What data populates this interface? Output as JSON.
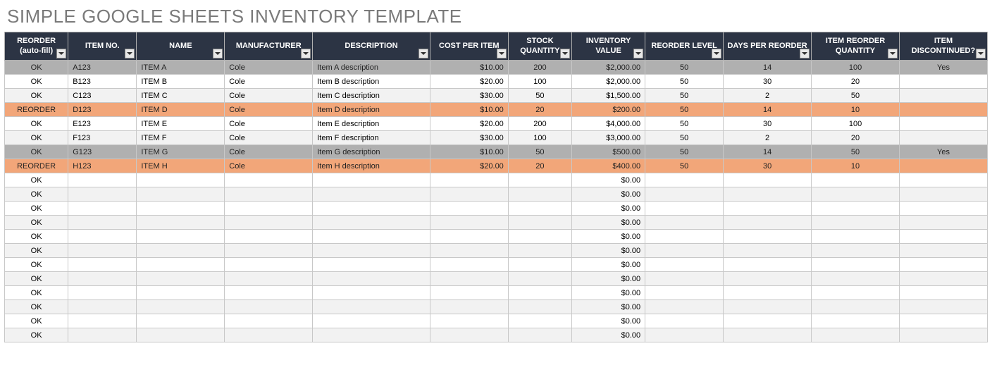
{
  "title": "SIMPLE GOOGLE SHEETS INVENTORY TEMPLATE",
  "columns": [
    {
      "key": "reorder",
      "label": "REORDER (auto-fill)"
    },
    {
      "key": "item_no",
      "label": "ITEM NO."
    },
    {
      "key": "name",
      "label": "NAME"
    },
    {
      "key": "manufacturer",
      "label": "MANUFACTURER"
    },
    {
      "key": "description",
      "label": "DESCRIPTION"
    },
    {
      "key": "cost_per_item",
      "label": "COST PER ITEM"
    },
    {
      "key": "stock_qty",
      "label": "STOCK QUANTITY"
    },
    {
      "key": "inventory_value",
      "label": "INVENTORY VALUE"
    },
    {
      "key": "reorder_level",
      "label": "REORDER LEVEL"
    },
    {
      "key": "days_per_reorder",
      "label": "DAYS PER REORDER"
    },
    {
      "key": "item_reorder_qty",
      "label": "ITEM REORDER QUANTITY"
    },
    {
      "key": "discontinued",
      "label": "ITEM DISCONTINUED?"
    }
  ],
  "rows": [
    {
      "state": "disc",
      "reorder": "OK",
      "item_no": "A123",
      "name": "ITEM A",
      "manufacturer": "Cole",
      "description": "Item A description",
      "cost_per_item": "$10.00",
      "stock_qty": "200",
      "inventory_value": "$2,000.00",
      "reorder_level": "50",
      "days_per_reorder": "14",
      "item_reorder_qty": "100",
      "discontinued": "Yes"
    },
    {
      "state": "normal",
      "reorder": "OK",
      "item_no": "B123",
      "name": "ITEM B",
      "manufacturer": "Cole",
      "description": "Item B description",
      "cost_per_item": "$20.00",
      "stock_qty": "100",
      "inventory_value": "$2,000.00",
      "reorder_level": "50",
      "days_per_reorder": "30",
      "item_reorder_qty": "20",
      "discontinued": ""
    },
    {
      "state": "normal",
      "reorder": "OK",
      "item_no": "C123",
      "name": "ITEM C",
      "manufacturer": "Cole",
      "description": "Item C description",
      "cost_per_item": "$30.00",
      "stock_qty": "50",
      "inventory_value": "$1,500.00",
      "reorder_level": "50",
      "days_per_reorder": "2",
      "item_reorder_qty": "50",
      "discontinued": ""
    },
    {
      "state": "reorder",
      "reorder": "REORDER",
      "item_no": "D123",
      "name": "ITEM D",
      "manufacturer": "Cole",
      "description": "Item D description",
      "cost_per_item": "$10.00",
      "stock_qty": "20",
      "inventory_value": "$200.00",
      "reorder_level": "50",
      "days_per_reorder": "14",
      "item_reorder_qty": "10",
      "discontinued": ""
    },
    {
      "state": "normal",
      "reorder": "OK",
      "item_no": "E123",
      "name": "ITEM E",
      "manufacturer": "Cole",
      "description": "Item E description",
      "cost_per_item": "$20.00",
      "stock_qty": "200",
      "inventory_value": "$4,000.00",
      "reorder_level": "50",
      "days_per_reorder": "30",
      "item_reorder_qty": "100",
      "discontinued": ""
    },
    {
      "state": "normal",
      "reorder": "OK",
      "item_no": "F123",
      "name": "ITEM F",
      "manufacturer": "Cole",
      "description": "Item F description",
      "cost_per_item": "$30.00",
      "stock_qty": "100",
      "inventory_value": "$3,000.00",
      "reorder_level": "50",
      "days_per_reorder": "2",
      "item_reorder_qty": "20",
      "discontinued": ""
    },
    {
      "state": "disc",
      "reorder": "OK",
      "item_no": "G123",
      "name": "ITEM G",
      "manufacturer": "Cole",
      "description": "Item G description",
      "cost_per_item": "$10.00",
      "stock_qty": "50",
      "inventory_value": "$500.00",
      "reorder_level": "50",
      "days_per_reorder": "14",
      "item_reorder_qty": "50",
      "discontinued": "Yes"
    },
    {
      "state": "reorder",
      "reorder": "REORDER",
      "item_no": "H123",
      "name": "ITEM H",
      "manufacturer": "Cole",
      "description": "Item H description",
      "cost_per_item": "$20.00",
      "stock_qty": "20",
      "inventory_value": "$400.00",
      "reorder_level": "50",
      "days_per_reorder": "30",
      "item_reorder_qty": "10",
      "discontinued": ""
    },
    {
      "state": "normal",
      "reorder": "OK",
      "item_no": "",
      "name": "",
      "manufacturer": "",
      "description": "",
      "cost_per_item": "",
      "stock_qty": "",
      "inventory_value": "$0.00",
      "reorder_level": "",
      "days_per_reorder": "",
      "item_reorder_qty": "",
      "discontinued": ""
    },
    {
      "state": "normal",
      "reorder": "OK",
      "item_no": "",
      "name": "",
      "manufacturer": "",
      "description": "",
      "cost_per_item": "",
      "stock_qty": "",
      "inventory_value": "$0.00",
      "reorder_level": "",
      "days_per_reorder": "",
      "item_reorder_qty": "",
      "discontinued": ""
    },
    {
      "state": "normal",
      "reorder": "OK",
      "item_no": "",
      "name": "",
      "manufacturer": "",
      "description": "",
      "cost_per_item": "",
      "stock_qty": "",
      "inventory_value": "$0.00",
      "reorder_level": "",
      "days_per_reorder": "",
      "item_reorder_qty": "",
      "discontinued": ""
    },
    {
      "state": "normal",
      "reorder": "OK",
      "item_no": "",
      "name": "",
      "manufacturer": "",
      "description": "",
      "cost_per_item": "",
      "stock_qty": "",
      "inventory_value": "$0.00",
      "reorder_level": "",
      "days_per_reorder": "",
      "item_reorder_qty": "",
      "discontinued": ""
    },
    {
      "state": "normal",
      "reorder": "OK",
      "item_no": "",
      "name": "",
      "manufacturer": "",
      "description": "",
      "cost_per_item": "",
      "stock_qty": "",
      "inventory_value": "$0.00",
      "reorder_level": "",
      "days_per_reorder": "",
      "item_reorder_qty": "",
      "discontinued": ""
    },
    {
      "state": "normal",
      "reorder": "OK",
      "item_no": "",
      "name": "",
      "manufacturer": "",
      "description": "",
      "cost_per_item": "",
      "stock_qty": "",
      "inventory_value": "$0.00",
      "reorder_level": "",
      "days_per_reorder": "",
      "item_reorder_qty": "",
      "discontinued": ""
    },
    {
      "state": "normal",
      "reorder": "OK",
      "item_no": "",
      "name": "",
      "manufacturer": "",
      "description": "",
      "cost_per_item": "",
      "stock_qty": "",
      "inventory_value": "$0.00",
      "reorder_level": "",
      "days_per_reorder": "",
      "item_reorder_qty": "",
      "discontinued": ""
    },
    {
      "state": "normal",
      "reorder": "OK",
      "item_no": "",
      "name": "",
      "manufacturer": "",
      "description": "",
      "cost_per_item": "",
      "stock_qty": "",
      "inventory_value": "$0.00",
      "reorder_level": "",
      "days_per_reorder": "",
      "item_reorder_qty": "",
      "discontinued": ""
    },
    {
      "state": "normal",
      "reorder": "OK",
      "item_no": "",
      "name": "",
      "manufacturer": "",
      "description": "",
      "cost_per_item": "",
      "stock_qty": "",
      "inventory_value": "$0.00",
      "reorder_level": "",
      "days_per_reorder": "",
      "item_reorder_qty": "",
      "discontinued": ""
    },
    {
      "state": "normal",
      "reorder": "OK",
      "item_no": "",
      "name": "",
      "manufacturer": "",
      "description": "",
      "cost_per_item": "",
      "stock_qty": "",
      "inventory_value": "$0.00",
      "reorder_level": "",
      "days_per_reorder": "",
      "item_reorder_qty": "",
      "discontinued": ""
    },
    {
      "state": "normal",
      "reorder": "OK",
      "item_no": "",
      "name": "",
      "manufacturer": "",
      "description": "",
      "cost_per_item": "",
      "stock_qty": "",
      "inventory_value": "$0.00",
      "reorder_level": "",
      "days_per_reorder": "",
      "item_reorder_qty": "",
      "discontinued": ""
    },
    {
      "state": "normal",
      "reorder": "OK",
      "item_no": "",
      "name": "",
      "manufacturer": "",
      "description": "",
      "cost_per_item": "",
      "stock_qty": "",
      "inventory_value": "$0.00",
      "reorder_level": "",
      "days_per_reorder": "",
      "item_reorder_qty": "",
      "discontinued": ""
    }
  ],
  "chart_data": {
    "type": "table",
    "title": "Simple Google Sheets Inventory Template",
    "columns": [
      "REORDER (auto-fill)",
      "ITEM NO.",
      "NAME",
      "MANUFACTURER",
      "DESCRIPTION",
      "COST PER ITEM",
      "STOCK QUANTITY",
      "INVENTORY VALUE",
      "REORDER LEVEL",
      "DAYS PER REORDER",
      "ITEM REORDER QUANTITY",
      "ITEM DISCONTINUED?"
    ],
    "rows": [
      [
        "OK",
        "A123",
        "ITEM A",
        "Cole",
        "Item A description",
        10.0,
        200,
        2000.0,
        50,
        14,
        100,
        "Yes"
      ],
      [
        "OK",
        "B123",
        "ITEM B",
        "Cole",
        "Item B description",
        20.0,
        100,
        2000.0,
        50,
        30,
        20,
        ""
      ],
      [
        "OK",
        "C123",
        "ITEM C",
        "Cole",
        "Item C description",
        30.0,
        50,
        1500.0,
        50,
        2,
        50,
        ""
      ],
      [
        "REORDER",
        "D123",
        "ITEM D",
        "Cole",
        "Item D description",
        10.0,
        20,
        200.0,
        50,
        14,
        10,
        ""
      ],
      [
        "OK",
        "E123",
        "ITEM E",
        "Cole",
        "Item E description",
        20.0,
        200,
        4000.0,
        50,
        30,
        100,
        ""
      ],
      [
        "OK",
        "F123",
        "ITEM F",
        "Cole",
        "Item F description",
        30.0,
        100,
        3000.0,
        50,
        2,
        20,
        ""
      ],
      [
        "OK",
        "G123",
        "ITEM G",
        "Cole",
        "Item G description",
        10.0,
        50,
        500.0,
        50,
        14,
        50,
        "Yes"
      ],
      [
        "REORDER",
        "H123",
        "ITEM H",
        "Cole",
        "Item H description",
        20.0,
        20,
        400.0,
        50,
        30,
        10,
        ""
      ]
    ]
  }
}
